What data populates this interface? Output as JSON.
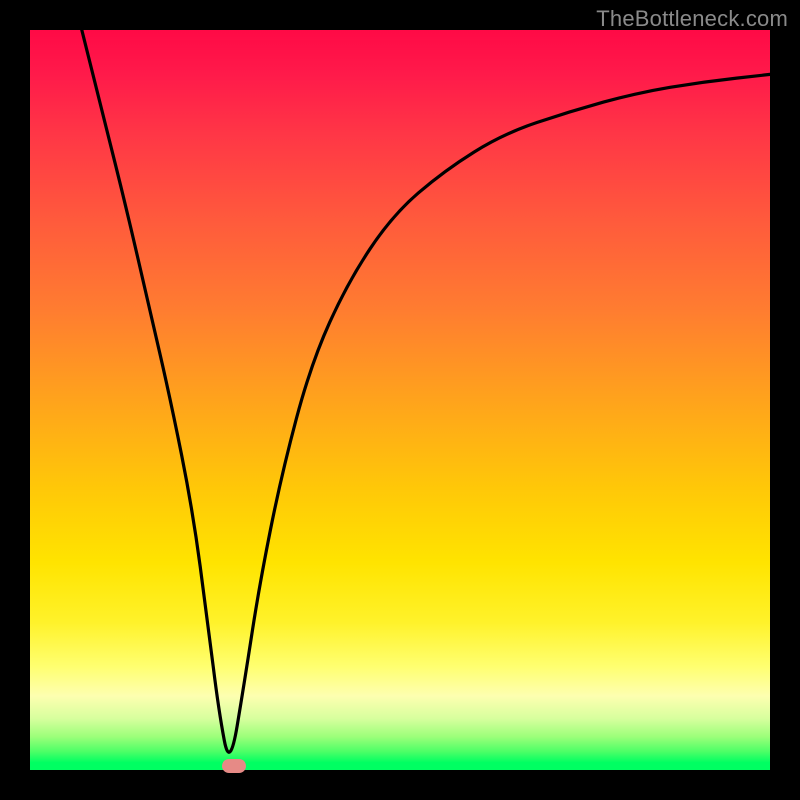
{
  "watermark": "TheBottleneck.com",
  "chart_data": {
    "type": "line",
    "title": "",
    "xlabel": "",
    "ylabel": "",
    "xlim": [
      0,
      100
    ],
    "ylim": [
      0,
      100
    ],
    "series": [
      {
        "name": "curve",
        "x": [
          7,
          10,
          13,
          16,
          19,
          22,
          24,
          25.5,
          27,
          29,
          31,
          34,
          38,
          43,
          49,
          56,
          64,
          73,
          82,
          91,
          100
        ],
        "y": [
          100,
          88,
          76,
          63,
          50,
          35,
          20,
          8,
          0,
          12,
          25,
          40,
          55,
          66,
          75,
          81,
          86,
          89,
          91.5,
          93,
          94
        ]
      }
    ],
    "marker": {
      "x": 27.5,
      "y": 0.5,
      "color": "#e68a86"
    },
    "gradient_stops": [
      {
        "pos": 0,
        "color": "#ff0a46"
      },
      {
        "pos": 50,
        "color": "#ffa31c"
      },
      {
        "pos": 80,
        "color": "#fff22a"
      },
      {
        "pos": 100,
        "color": "#00ff62"
      }
    ]
  }
}
